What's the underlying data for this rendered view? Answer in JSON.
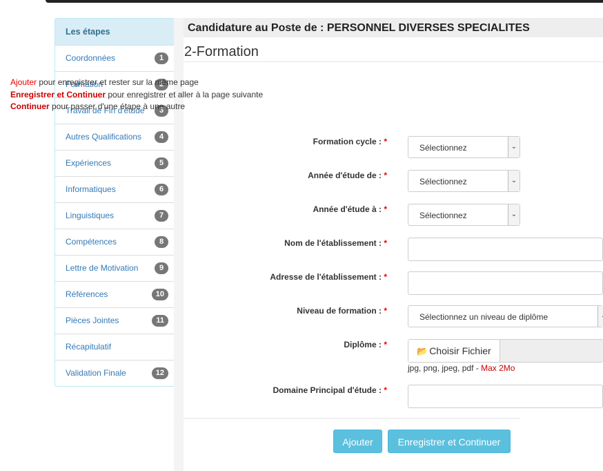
{
  "sidebar": {
    "title": "Les étapes",
    "items": [
      {
        "label": "Coordonnées",
        "badge": "1"
      },
      {
        "label": "Formation",
        "badge": "2"
      },
      {
        "label": "Travail de Fin d'étude",
        "badge": "3"
      },
      {
        "label": "Autres Qualifications",
        "badge": "4"
      },
      {
        "label": "Expériences",
        "badge": "5"
      },
      {
        "label": "Informatiques",
        "badge": "6"
      },
      {
        "label": "Linguistiques",
        "badge": "7"
      },
      {
        "label": "Compétences",
        "badge": "8"
      },
      {
        "label": "Lettre de Motivation",
        "badge": "9"
      },
      {
        "label": "Références",
        "badge": "10"
      },
      {
        "label": "Pièces Jointes",
        "badge": "11"
      },
      {
        "label": "Récapitulatif",
        "badge": ""
      },
      {
        "label": "Validation Finale",
        "badge": "12"
      }
    ]
  },
  "header": {
    "title": "Candidature au Poste de : PERSONNEL DIVERSES SPECIALITES",
    "section": "2-Formation"
  },
  "instructions": {
    "line1_key": "Ajouter",
    "line1_text": " pour enregistrer et rester sur la même page",
    "line2_key": "Enregistrer et Continuer",
    "line2_text": " pour enregistrer et aller à la page suivante",
    "line3_key": "Continuer",
    "line3_text": " pour passer d'une étape à une autre"
  },
  "form": {
    "required_mark": "*",
    "formation_cycle": {
      "label": "Formation cycle :",
      "value": "Sélectionnez"
    },
    "annee_de": {
      "label": "Année d'étude de :",
      "value": "Sélectionnez"
    },
    "annee_a": {
      "label": "Année d'étude à :",
      "value": "Sélectionnez"
    },
    "nom_etablissement": {
      "label": "Nom de l'établissement :",
      "value": ""
    },
    "adresse_etablissement": {
      "label": "Adresse de l'établissement :",
      "value": ""
    },
    "niveau_formation": {
      "label": "Niveau de formation :",
      "value": "Sélectionnez un niveau de diplôme"
    },
    "diplome": {
      "label": "Diplôme :",
      "button": "Choisir Fichier",
      "hint": "jpg, png, jpeg, pdf - ",
      "hint_max": "Max 2Mo"
    },
    "domaine": {
      "label": "Domaine Principal d'étude :",
      "value": ""
    }
  },
  "buttons": {
    "add": "Ajouter",
    "save_continue": "Enregistrer et Continuer"
  },
  "colors": {
    "accent": "#5bc0de",
    "link": "#337ab7",
    "sidebar_head_bg": "#d9edf7",
    "required": "#ee0000"
  },
  "icons": {
    "folder": "folder-open-icon",
    "select_arrow": "chevron-down-icon"
  }
}
